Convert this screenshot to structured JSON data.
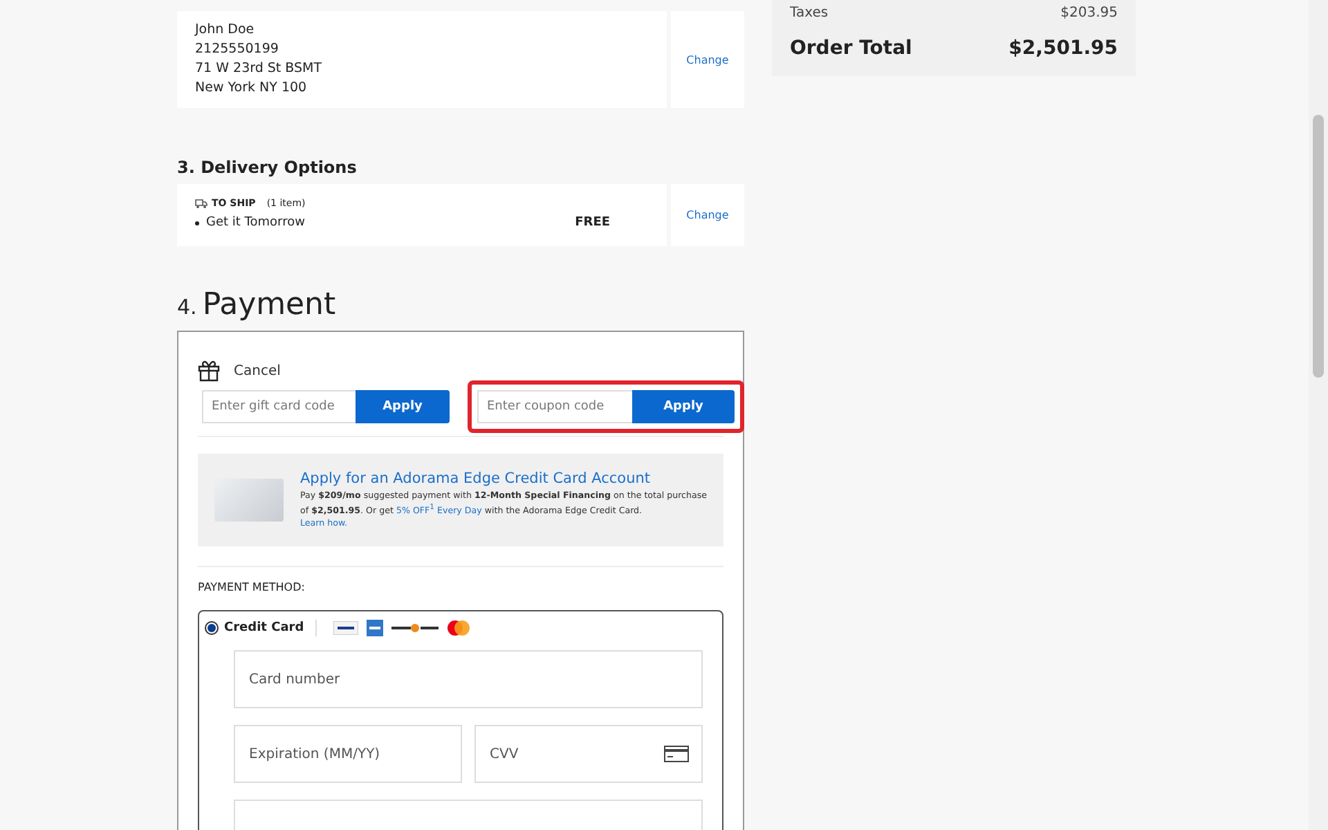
{
  "shipping_address": {
    "lines": [
      "John Doe",
      "2125550199",
      "71 W 23rd St BSMT",
      "New York NY 100"
    ],
    "change": "Change"
  },
  "delivery": {
    "title": "3. Delivery Options",
    "ship_label": "TO SHIP",
    "item_count": "(1 item)",
    "option": "Get it Tomorrow",
    "price": "FREE",
    "change": "Change"
  },
  "payment": {
    "number": "4.",
    "title": "Payment",
    "gift_toggle": "Cancel",
    "gift_placeholder": "Enter gift card code",
    "gift_apply": "Apply",
    "coupon_placeholder": "Enter coupon code",
    "coupon_apply": "Apply",
    "coupon_highlighted": true
  },
  "promo": {
    "title": "Apply for an Adorama Edge Credit Card Account",
    "text_before": "Pay **$209/mo** suggested payment with **12-Month Special Financing** on the total purchase of **$2,501.95**. Or get ",
    "link": "5% OFF$^{1}$ Every Day",
    "text_after": " with the Adorama Edge Credit Card.",
    "learn_more": "Learn how."
  },
  "payment_method": {
    "label": "PAYMENT METHOD:",
    "options": [
      {
        "label": "Credit Card",
        "selected": true
      }
    ],
    "card_number_placeholder": "Card number",
    "expiration_placeholder": "Expiration (MM/YY)",
    "cvv_placeholder": "CVV"
  },
  "summary": {
    "rows": [
      {
        "label": "Taxes",
        "value": "$203.95"
      }
    ],
    "total_label": "Order Total",
    "total_value": "$2,501.95"
  }
}
